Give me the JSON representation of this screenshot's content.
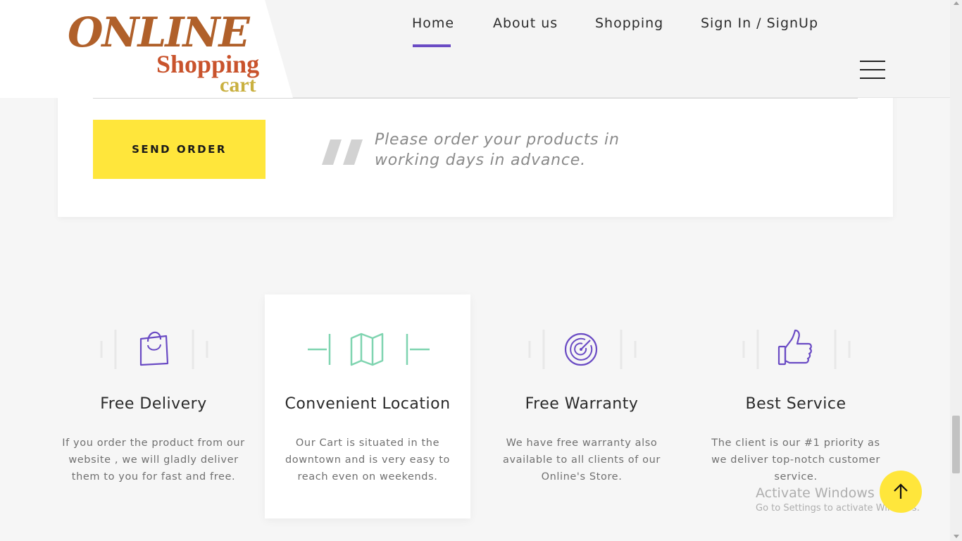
{
  "header": {
    "logo": {
      "line1": "ONLINE",
      "line2": "Shopping",
      "line3": "cart"
    },
    "nav": [
      {
        "label": "Home",
        "active": true
      },
      {
        "label": "About us",
        "active": false
      },
      {
        "label": "Shopping",
        "active": false
      },
      {
        "label": "Sign In / SignUp",
        "active": false
      }
    ],
    "menu_icon": "hamburger-icon"
  },
  "order": {
    "send_button_label": "SEND ORDER",
    "note": "Please order your products in working days in advance.",
    "quote_icon": "quote-icon"
  },
  "features": [
    {
      "icon": "shopping-bag-icon",
      "title": "Free Delivery",
      "description": "If you order the product from our website , we will gladly deliver them to you for fast and free."
    },
    {
      "icon": "map-icon",
      "title": "Convenient Location",
      "description": "Our Cart is situated in the downtown and is very easy to reach even on weekends."
    },
    {
      "icon": "target-icon",
      "title": "Free Warranty",
      "description": "We have free warranty also available to all clients of our Online's Store."
    },
    {
      "icon": "thumbs-up-icon",
      "title": "Best Service",
      "description": "The client is our #1 priority as we deliver top-notch customer service."
    }
  ],
  "back_to_top_icon": "arrow-up-icon",
  "watermark": {
    "title": "Activate Windows",
    "subtitle": "Go to Settings to activate Windows."
  },
  "colors": {
    "accent_purple": "#6a4bc4",
    "button_yellow": "#ffe63b",
    "icon_green": "#7fd4b0",
    "logo_brown": "#b0602a"
  }
}
